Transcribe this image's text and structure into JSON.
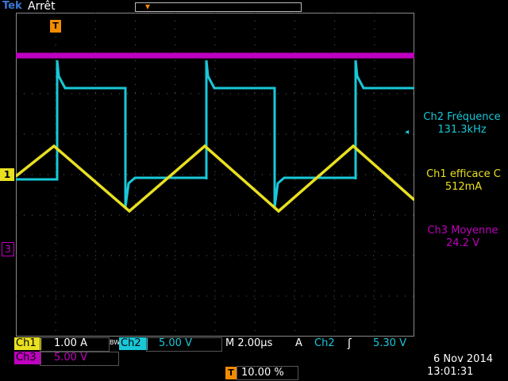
{
  "header": {
    "brand": "Tek",
    "state": "Arrêt"
  },
  "markers": {
    "trigger_position": "T",
    "ch1": "1",
    "ch3": "3",
    "ch2_level": "◂"
  },
  "measurements": [
    {
      "name": "Ch2 Fréquence",
      "value": "131.3kHz"
    },
    {
      "name": "Ch1 efficace C",
      "value": "512mA"
    },
    {
      "name": "Ch3 Moyenne",
      "value": "24.2 V"
    }
  ],
  "status": {
    "ch1_label": "Ch1",
    "ch1_scale": "1.00 A",
    "bw": "BW",
    "ch2_label": "Ch2",
    "ch2_scale": "5.00 V",
    "timebase": "M 2.00µs",
    "trigger_mode": "A",
    "trigger_source": "Ch2",
    "trigger_slope": "ʃ",
    "trigger_level": "5.30 V",
    "ch3_label": "Ch3",
    "ch3_scale": "5.00 V",
    "trigger_pos_icon": "T",
    "trigger_pos_value": "10.00 %",
    "date": "6 Nov 2014",
    "time": "13:01:31"
  },
  "colors": {
    "ch1": "#e8e020",
    "ch2": "#18c8d8",
    "ch3": "#c000c0",
    "trigger": "#f28c00",
    "grid": "#606060"
  }
}
